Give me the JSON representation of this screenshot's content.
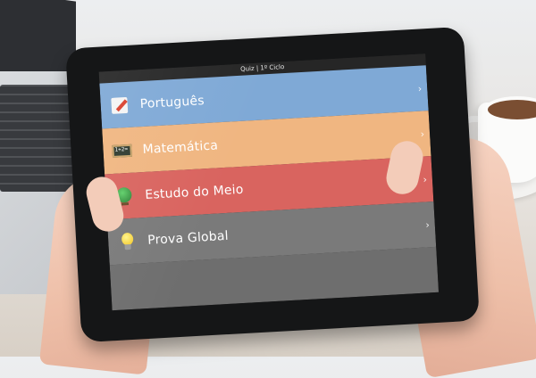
{
  "app": {
    "title": "Quiz | 1º Ciclo"
  },
  "menu": {
    "items": [
      {
        "label": "Português",
        "icon": "pencil-paper-icon",
        "color": "#7fa9d6"
      },
      {
        "label": "Matemática",
        "icon": "chalkboard-icon",
        "color": "#f0b681",
        "icon_text": "1+2="
      },
      {
        "label": "Estudo do Meio",
        "icon": "globe-icon",
        "color": "#d9645f"
      },
      {
        "label": "Prova Global",
        "icon": "lightbulb-icon",
        "color": "#7a7a7a"
      }
    ],
    "chevron": "›"
  }
}
